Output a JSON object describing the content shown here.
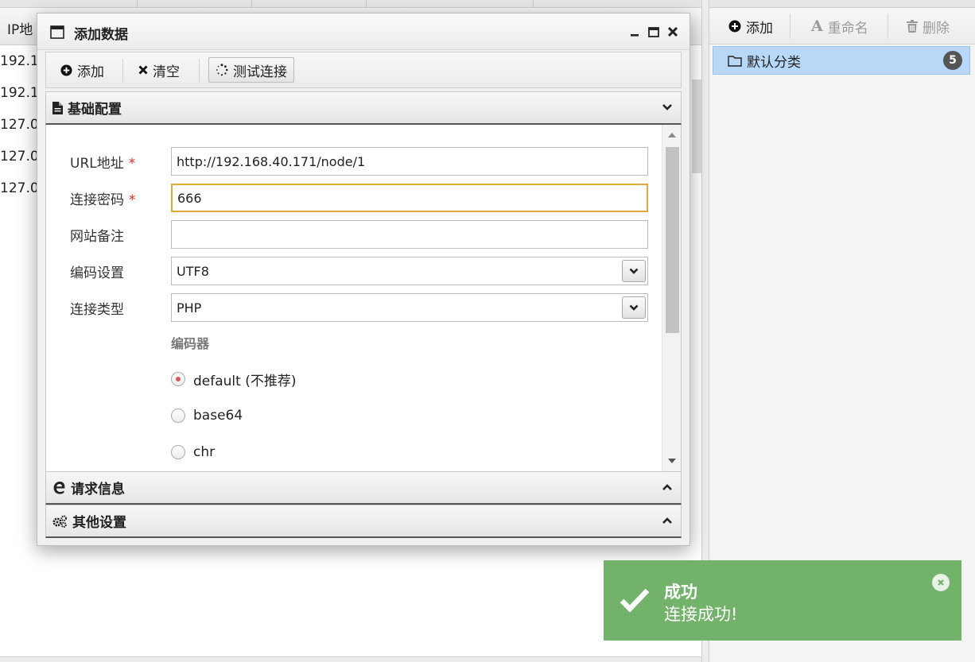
{
  "background": {
    "column_header": "IP地",
    "rows": [
      "192.1",
      "192.1",
      "127.0",
      "127.0",
      "127.0"
    ]
  },
  "right_panel": {
    "toolbar": {
      "add_label": "添加",
      "rename_label": "重命名",
      "delete_label": "删除"
    },
    "category": {
      "label": "默认分类",
      "count": "5"
    }
  },
  "dialog": {
    "title": "添加数据",
    "toolbar": {
      "add_label": "添加",
      "clear_label": "清空",
      "test_label": "测试连接"
    },
    "sections": {
      "basic": "基础配置",
      "request": "请求信息",
      "other": "其他设置"
    },
    "form": {
      "url_label": "URL地址",
      "url_value": "http://192.168.40.171/node/1",
      "password_label": "连接密码",
      "password_value": "666",
      "note_label": "网站备注",
      "note_value": "",
      "encoding_label": "编码设置",
      "encoding_value": "UTF8",
      "type_label": "连接类型",
      "type_value": "PHP",
      "required_mark": "*",
      "encoder_heading": "编码器",
      "encoders": [
        {
          "label": "default (不推荐)",
          "selected": true
        },
        {
          "label": "base64",
          "selected": false
        },
        {
          "label": "chr",
          "selected": false
        }
      ]
    }
  },
  "toast": {
    "title": "成功",
    "message": "连接成功!",
    "color": "#72b26a"
  }
}
